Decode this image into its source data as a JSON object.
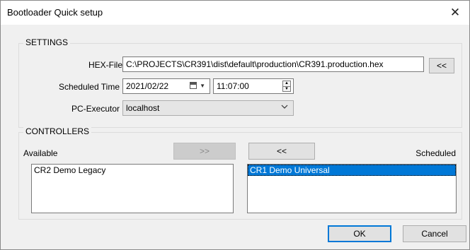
{
  "window": {
    "title": "Bootloader Quick setup"
  },
  "settings": {
    "legend": "SETTINGS",
    "hex_file": {
      "label": "HEX-File",
      "value": "C:\\PROJECTS\\CR391\\dist\\default\\production\\CR391.production.hex",
      "browse_label": "<<"
    },
    "scheduled_time": {
      "label": "Scheduled Time",
      "date": "2021/02/22",
      "time": "11:07:00"
    },
    "pc_executor": {
      "label": "PC-Executor",
      "value": "localhost"
    }
  },
  "controllers": {
    "legend": "CONTROLLERS",
    "available_label": "Available",
    "scheduled_label": "Scheduled",
    "move_right_label": ">>",
    "move_left_label": "<<",
    "available": [
      "CR2 Demo Legacy"
    ],
    "scheduled": [
      "CR1 Demo Universal"
    ]
  },
  "footer": {
    "ok_label": "OK",
    "cancel_label": "Cancel"
  },
  "colors": {
    "selection": "#0078d7",
    "background": "#f0f0f0",
    "accent_border": "#0078d7"
  }
}
